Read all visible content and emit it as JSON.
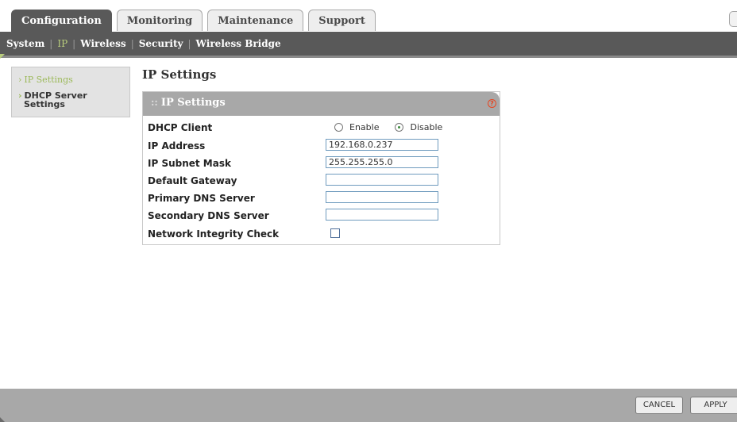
{
  "top_tabs": [
    {
      "label": "Configuration",
      "active": true
    },
    {
      "label": "Monitoring",
      "active": false
    },
    {
      "label": "Maintenance",
      "active": false
    },
    {
      "label": "Support",
      "active": false
    }
  ],
  "subnav": {
    "items": [
      {
        "label": "System",
        "active": false
      },
      {
        "label": "IP",
        "active": true
      },
      {
        "label": "Wireless",
        "active": false
      },
      {
        "label": "Security",
        "active": false
      },
      {
        "label": "Wireless Bridge",
        "active": false
      }
    ],
    "separator": "|"
  },
  "sidebar": {
    "arrow": "›",
    "items": [
      {
        "label": "IP Settings",
        "active": true
      },
      {
        "label_line1": "DHCP Server",
        "label_line2": "Settings",
        "active": false
      }
    ]
  },
  "main": {
    "page_title": "IP Settings",
    "panel_title": "IP Settings",
    "panel_title_prefix": "::",
    "help_icon": "question-circle-icon",
    "help_glyph": "?",
    "dhcp_client": {
      "label": "DHCP Client",
      "options": [
        {
          "label": "Enable",
          "checked": false
        },
        {
          "label": "Disable",
          "checked": true
        }
      ]
    },
    "fields": [
      {
        "label": "IP Address",
        "value": "192.168.0.237"
      },
      {
        "label": "IP Subnet Mask",
        "value": "255.255.255.0"
      },
      {
        "label": "Default Gateway",
        "value": ""
      },
      {
        "label": "Primary DNS Server",
        "value": ""
      },
      {
        "label": "Secondary DNS Server",
        "value": ""
      }
    ],
    "network_integrity_check": {
      "label": "Network Integrity Check",
      "checked": false
    }
  },
  "footer": {
    "cancel_label": "CANCEL",
    "apply_label": "APPLY"
  },
  "colors": {
    "dark_bar": "#595959",
    "accent_green": "#9cb95a",
    "panel_header": "#a8a8a8",
    "help_red": "#e8451f",
    "input_border": "#6f9bbe"
  }
}
